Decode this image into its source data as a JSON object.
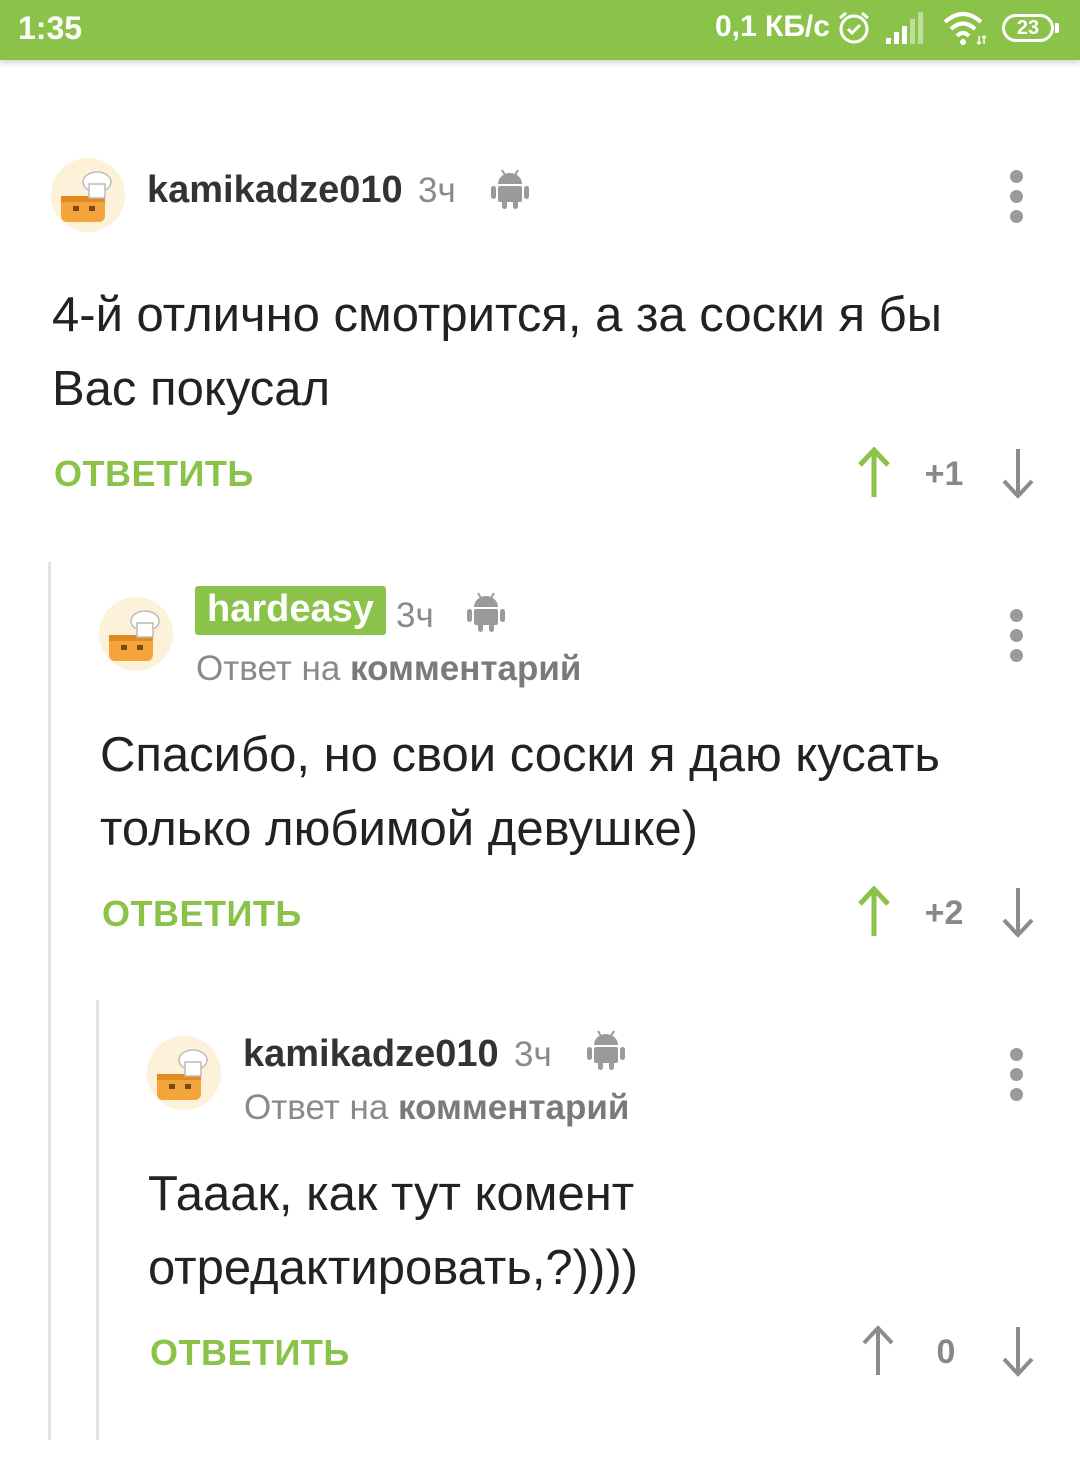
{
  "status_bar": {
    "time": "1:35",
    "net_speed": "0,1 КБ/с",
    "battery": "23"
  },
  "colors": {
    "accent": "#8bc34a",
    "muted": "#8a8a8a"
  },
  "comments": [
    {
      "username": "kamikadze010",
      "time": "3ч",
      "reply_prefix": "",
      "reply_target": "",
      "text_lines": [
        "4-й отлично смотрится, а за соски я бы",
        "Вас покусал"
      ],
      "reply_label": "ОТВЕТИТЬ",
      "score": "+1",
      "icon_upvote": "arrow-up-icon",
      "icon_downvote": "arrow-down-icon"
    },
    {
      "username": "hardeasy",
      "time": "3ч",
      "reply_prefix": "Ответ на",
      "reply_target": "комментарий",
      "text_lines": [
        "Спасибо, но свои соски я даю кусать",
        "только любимой девушке)"
      ],
      "reply_label": "ОТВЕТИТЬ",
      "score": "+2"
    },
    {
      "username": "kamikadze010",
      "time": "3ч",
      "reply_prefix": "Ответ на",
      "reply_target": "комментарий",
      "text_lines": [
        "Тааак, как тут комент",
        "отредактировать,?))))"
      ],
      "reply_label": "ОТВЕТИТЬ",
      "score": "0"
    }
  ]
}
